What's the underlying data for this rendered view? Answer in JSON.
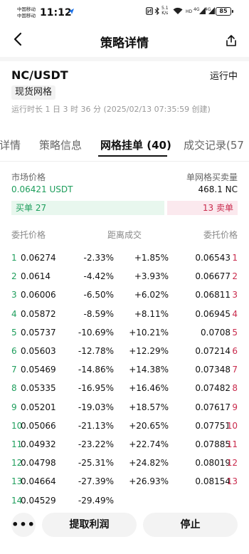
{
  "status_bar": {
    "carrier1": "中国移动",
    "carrier2": "中国移动",
    "time": "11:12",
    "speed_value": "5.1",
    "speed_unit": "K/s",
    "signal1": "4G",
    "signal2": "4G",
    "battery": "85"
  },
  "header": {
    "title": "策略详情"
  },
  "strategy": {
    "pair": "NC/USDT",
    "status": "运行中",
    "tag": "现货网格",
    "runtime": "运行时长 1 日 3 时 36 分 (2025/02/13 07:35:59 创建)"
  },
  "tabs": [
    "详情",
    "策略信息",
    "网格挂单 (40)",
    "成交记录(57"
  ],
  "market": {
    "price_label": "市场价格",
    "price_value": "0.06421 USDT",
    "per_grid_label": "单网格买卖量",
    "per_grid_value": "468.1 NC"
  },
  "orders": {
    "buy_label": "买单 27",
    "sell_label": "13 卖单"
  },
  "table": {
    "headers": {
      "buy_price": "委托价格",
      "distance": "距离成交",
      "sell_price": "委托价格"
    },
    "rows": [
      {
        "idx": "1",
        "buy": "0.06274",
        "buy_dist": "-2.33%",
        "sell_dist": "+1.85%",
        "sell": "0.06543",
        "sidx": "1"
      },
      {
        "idx": "2",
        "buy": "0.0614",
        "buy_dist": "-4.42%",
        "sell_dist": "+3.93%",
        "sell": "0.06677",
        "sidx": "2"
      },
      {
        "idx": "3",
        "buy": "0.06006",
        "buy_dist": "-6.50%",
        "sell_dist": "+6.02%",
        "sell": "0.06811",
        "sidx": "3"
      },
      {
        "idx": "4",
        "buy": "0.05872",
        "buy_dist": "-8.59%",
        "sell_dist": "+8.11%",
        "sell": "0.06945",
        "sidx": "4"
      },
      {
        "idx": "5",
        "buy": "0.05737",
        "buy_dist": "-10.69%",
        "sell_dist": "+10.21%",
        "sell": "0.0708",
        "sidx": "5"
      },
      {
        "idx": "6",
        "buy": "0.05603",
        "buy_dist": "-12.78%",
        "sell_dist": "+12.29%",
        "sell": "0.07214",
        "sidx": "6"
      },
      {
        "idx": "7",
        "buy": "0.05469",
        "buy_dist": "-14.86%",
        "sell_dist": "+14.38%",
        "sell": "0.07348",
        "sidx": "7"
      },
      {
        "idx": "8",
        "buy": "0.05335",
        "buy_dist": "-16.95%",
        "sell_dist": "+16.46%",
        "sell": "0.07482",
        "sidx": "8"
      },
      {
        "idx": "9",
        "buy": "0.05201",
        "buy_dist": "-19.03%",
        "sell_dist": "+18.57%",
        "sell": "0.07617",
        "sidx": "9"
      },
      {
        "idx": "10",
        "buy": "0.05066",
        "buy_dist": "-21.13%",
        "sell_dist": "+20.65%",
        "sell": "0.07751",
        "sidx": "10"
      },
      {
        "idx": "11",
        "buy": "0.04932",
        "buy_dist": "-23.22%",
        "sell_dist": "+22.74%",
        "sell": "0.07885",
        "sidx": "11"
      },
      {
        "idx": "12",
        "buy": "0.04798",
        "buy_dist": "-25.31%",
        "sell_dist": "+24.82%",
        "sell": "0.08019",
        "sidx": "12"
      },
      {
        "idx": "13",
        "buy": "0.04664",
        "buy_dist": "-27.39%",
        "sell_dist": "+26.93%",
        "sell": "0.08154",
        "sidx": "13"
      },
      {
        "idx": "14",
        "buy": "0.04529",
        "buy_dist": "-29.49%",
        "sell_dist": "",
        "sell": "",
        "sidx": ""
      }
    ]
  },
  "bottom": {
    "more": "•••",
    "withdraw": "提取利润",
    "stop": "停止"
  },
  "colors": {
    "buy_green": "#1e9e5c",
    "sell_red": "#c92a4c"
  }
}
